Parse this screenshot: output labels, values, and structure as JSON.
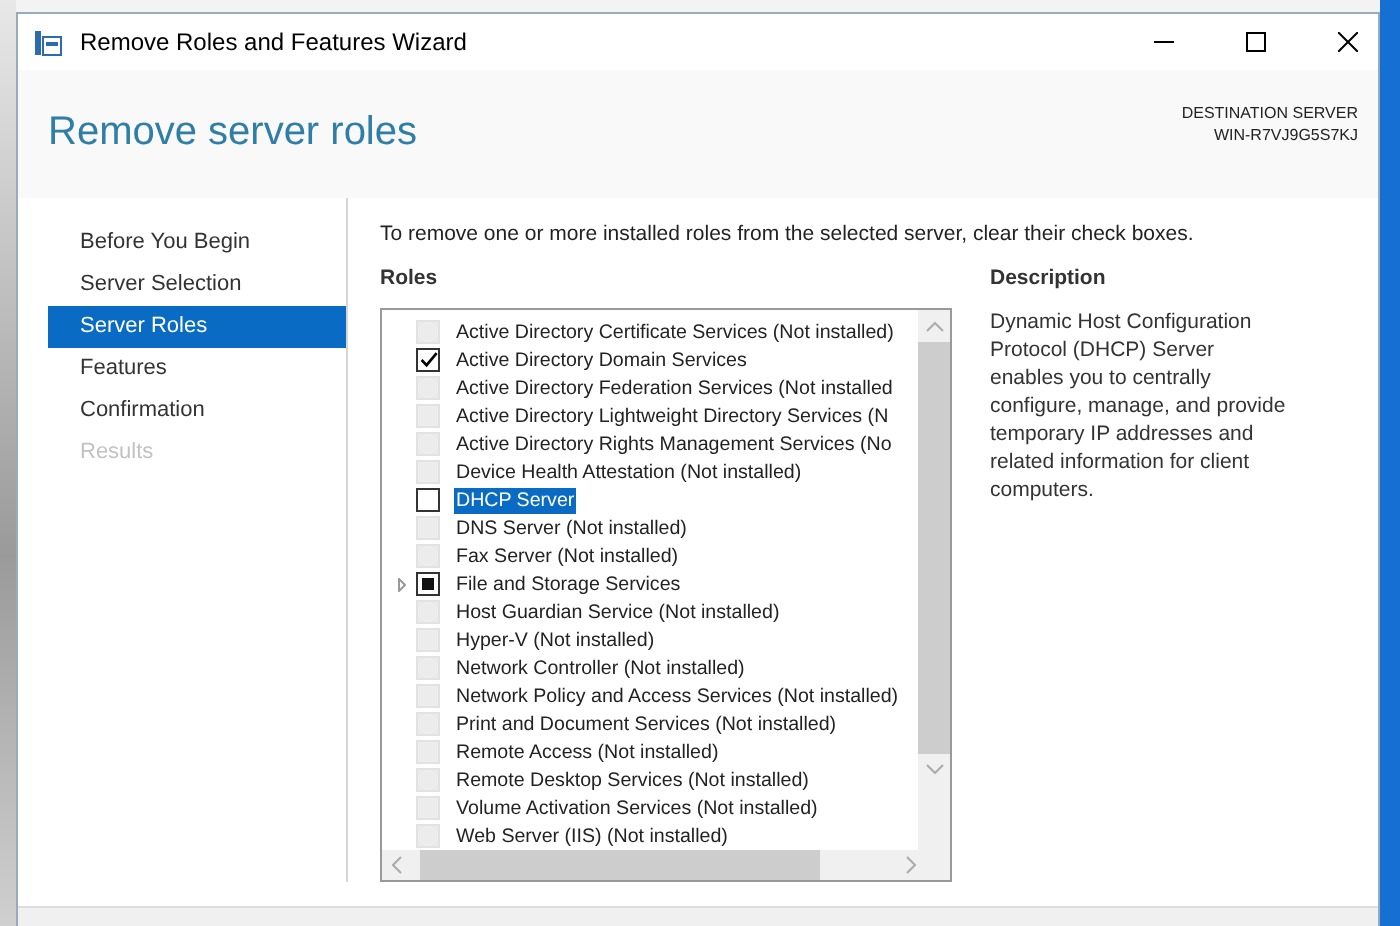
{
  "window": {
    "title": "Remove Roles and Features Wizard"
  },
  "header": {
    "title": "Remove server roles",
    "destination_label": "DESTINATION SERVER",
    "destination_server": "WIN-R7VJ9G5S7KJ"
  },
  "steps": [
    {
      "label": "Before You Begin",
      "selected": false,
      "disabled": false
    },
    {
      "label": "Server Selection",
      "selected": false,
      "disabled": false
    },
    {
      "label": "Server Roles",
      "selected": true,
      "disabled": false
    },
    {
      "label": "Features",
      "selected": false,
      "disabled": false
    },
    {
      "label": "Confirmation",
      "selected": false,
      "disabled": false
    },
    {
      "label": "Results",
      "selected": false,
      "disabled": true
    }
  ],
  "instruction": "To remove one or more installed roles from the selected server, clear their check boxes.",
  "roles": {
    "heading": "Roles",
    "items": [
      {
        "label": "Active Directory Certificate Services (Not installed)",
        "checked": false,
        "partial": false,
        "disabled": true,
        "selected": false,
        "expandable": false
      },
      {
        "label": "Active Directory Domain Services",
        "checked": true,
        "partial": false,
        "disabled": false,
        "selected": false,
        "expandable": false
      },
      {
        "label": "Active Directory Federation Services (Not installed",
        "checked": false,
        "partial": false,
        "disabled": true,
        "selected": false,
        "expandable": false
      },
      {
        "label": "Active Directory Lightweight Directory Services (N",
        "checked": false,
        "partial": false,
        "disabled": true,
        "selected": false,
        "expandable": false
      },
      {
        "label": "Active Directory Rights Management Services (No",
        "checked": false,
        "partial": false,
        "disabled": true,
        "selected": false,
        "expandable": false
      },
      {
        "label": "Device Health Attestation (Not installed)",
        "checked": false,
        "partial": false,
        "disabled": true,
        "selected": false,
        "expandable": false
      },
      {
        "label": "DHCP Server",
        "checked": false,
        "partial": false,
        "disabled": false,
        "selected": true,
        "expandable": false
      },
      {
        "label": "DNS Server (Not installed)",
        "checked": false,
        "partial": false,
        "disabled": true,
        "selected": false,
        "expandable": false
      },
      {
        "label": "Fax Server (Not installed)",
        "checked": false,
        "partial": false,
        "disabled": true,
        "selected": false,
        "expandable": false
      },
      {
        "label": "File and Storage Services",
        "checked": false,
        "partial": true,
        "disabled": false,
        "selected": false,
        "expandable": true
      },
      {
        "label": "Host Guardian Service (Not installed)",
        "checked": false,
        "partial": false,
        "disabled": true,
        "selected": false,
        "expandable": false
      },
      {
        "label": "Hyper-V (Not installed)",
        "checked": false,
        "partial": false,
        "disabled": true,
        "selected": false,
        "expandable": false
      },
      {
        "label": "Network Controller (Not installed)",
        "checked": false,
        "partial": false,
        "disabled": true,
        "selected": false,
        "expandable": false
      },
      {
        "label": "Network Policy and Access Services (Not installed)",
        "checked": false,
        "partial": false,
        "disabled": true,
        "selected": false,
        "expandable": false
      },
      {
        "label": "Print and Document Services (Not installed)",
        "checked": false,
        "partial": false,
        "disabled": true,
        "selected": false,
        "expandable": false
      },
      {
        "label": "Remote Access (Not installed)",
        "checked": false,
        "partial": false,
        "disabled": true,
        "selected": false,
        "expandable": false
      },
      {
        "label": "Remote Desktop Services (Not installed)",
        "checked": false,
        "partial": false,
        "disabled": true,
        "selected": false,
        "expandable": false
      },
      {
        "label": "Volume Activation Services (Not installed)",
        "checked": false,
        "partial": false,
        "disabled": true,
        "selected": false,
        "expandable": false
      },
      {
        "label": "Web Server (IIS) (Not installed)",
        "checked": false,
        "partial": false,
        "disabled": true,
        "selected": false,
        "expandable": false
      }
    ]
  },
  "description": {
    "heading": "Description",
    "text": "Dynamic Host Configuration Protocol (DHCP) Server enables you to centrally configure, manage, and provide temporary IP addresses and related information for client computers."
  }
}
